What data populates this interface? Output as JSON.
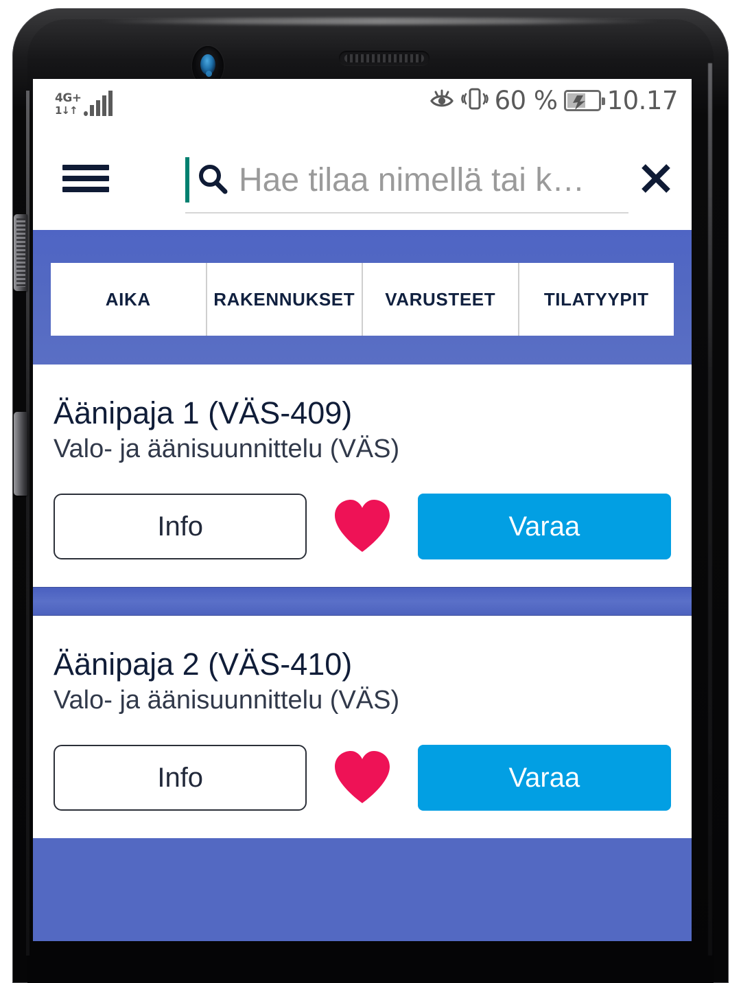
{
  "device": {
    "camera_icon": "front-camera",
    "speaker_icon": "earpiece-speaker",
    "volume_button": "volume-rocker",
    "power_button": "power-button"
  },
  "status_bar": {
    "network_label_top": "4G",
    "network_label_plus": "+",
    "network_label_bottom": "1↓↑",
    "signal_icon": "signal-bars-icon",
    "eye_icon": "eye-comfort-icon",
    "vibrate_icon": "vibrate-icon",
    "battery_percent": "60 %",
    "battery_icon": "battery-charging-icon",
    "clock": "10.17"
  },
  "app_bar": {
    "menu_icon": "hamburger-menu-icon",
    "search_icon": "search-icon",
    "clear_icon": "close-icon",
    "search_value": "",
    "search_placeholder": "Hae tilaa nimellä tai k…",
    "caret_color": "#008070"
  },
  "filters": {
    "background_color": "#5369c2",
    "tabs": [
      {
        "label": "AIKA",
        "name": "tab-aika"
      },
      {
        "label": "RAKENNUKSET",
        "name": "tab-rakennukset"
      },
      {
        "label": "VARUSTEET",
        "name": "tab-varusteet"
      },
      {
        "label": "TILATYYPIT",
        "name": "tab-tilatyypit"
      }
    ]
  },
  "results": {
    "accent_blue": "#029fe3",
    "heart_color": "#ee1256",
    "items": [
      {
        "title": "Äänipaja 1 (VÄS-409)",
        "subtitle": "Valo- ja äänisuunnittelu (VÄS)",
        "info_label": "Info",
        "favorite_icon": "heart-filled-icon",
        "reserve_label": "Varaa"
      },
      {
        "title": "Äänipaja 2 (VÄS-410)",
        "subtitle": "Valo- ja äänisuunnittelu (VÄS)",
        "info_label": "Info",
        "favorite_icon": "heart-filled-icon",
        "reserve_label": "Varaa"
      }
    ]
  }
}
